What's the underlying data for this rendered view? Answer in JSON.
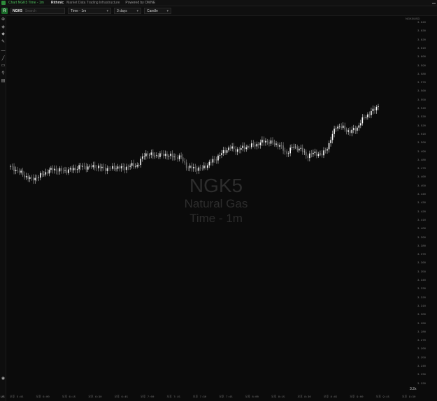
{
  "window": {
    "title": "Chart NGK5 Time - 1m",
    "brand": "Rithmic",
    "tagline": "Market Data Trading Infrastructure",
    "powered_by": "Powered by OMNE"
  },
  "toolbar": {
    "logo_glyph": "R",
    "symbol": "NGK5",
    "symbol_placeholder": "Search",
    "timeframe": "Time - 1m",
    "range": "3 days",
    "chart_type": "Candle"
  },
  "watermark": {
    "symbol": "NGK5",
    "name": "Natural Gas",
    "timeframe": "Time - 1m"
  },
  "left_tools": [
    {
      "icon": "zoom-icon",
      "glyph": "⊕"
    },
    {
      "icon": "layers-icon",
      "glyph": "◈"
    },
    {
      "icon": "drop-icon",
      "glyph": "◆"
    },
    {
      "icon": "pencil-icon",
      "glyph": "✎"
    },
    {
      "icon": "horizontal-line-icon",
      "glyph": "—"
    },
    {
      "icon": "trend-line-icon",
      "glyph": "╱"
    },
    {
      "icon": "rectangle-icon",
      "glyph": "▭"
    },
    {
      "icon": "fib-icon",
      "glyph": "⚲"
    },
    {
      "icon": "text-tool-icon",
      "glyph": "▤"
    }
  ],
  "bottom_tools": {
    "eye_glyph": "◉",
    "timezone": "US"
  },
  "axis_unit": "NGK5/USD",
  "zoom_label": "3.2x",
  "price_axis": [
    "3.640",
    "3.630",
    "3.620",
    "3.610",
    "3.600",
    "3.590",
    "3.580",
    "3.570",
    "3.560",
    "3.550",
    "3.540",
    "3.530",
    "3.520",
    "3.510",
    "3.500",
    "3.490",
    "3.480",
    "3.470",
    "3.460",
    "3.450",
    "3.440",
    "3.430",
    "3.420",
    "3.410",
    "3.400",
    "3.390",
    "3.380",
    "3.370",
    "3.360",
    "3.350",
    "3.340",
    "3.330",
    "3.320",
    "3.310",
    "3.300",
    "3.290",
    "3.280",
    "3.270",
    "3.260",
    "3.250",
    "3.240",
    "3.230",
    "3.220"
  ],
  "time_axis": [
    "오후 5:45",
    "오후 6:00",
    "오후 6:15",
    "오후 6:30",
    "오후 6:45",
    "오후 7:00",
    "오후 7:15",
    "오후 7:30",
    "오후 7:45",
    "오후 8:00",
    "오후 8:15",
    "오후 8:30",
    "오후 8:45",
    "오후 9:00",
    "오후 9:15",
    "오후 9:30"
  ],
  "chart_data": {
    "type": "candlestick",
    "ylim": [
      3.22,
      3.64
    ],
    "x": [
      "5:45",
      "5:49",
      "5:53",
      "5:57",
      "6:01",
      "6:05",
      "6:09",
      "6:13",
      "6:17",
      "6:21",
      "6:25",
      "6:29",
      "6:33",
      "6:37",
      "6:41",
      "6:45",
      "6:49",
      "6:53",
      "6:57",
      "7:01",
      "7:05",
      "7:09",
      "7:13",
      "7:17",
      "7:21",
      "7:25",
      "7:29",
      "7:33",
      "7:37",
      "7:41",
      "7:45",
      "7:49",
      "7:53",
      "7:57",
      "8:01",
      "8:05",
      "8:09",
      "8:13",
      "8:17",
      "8:21",
      "8:25",
      "8:29",
      "8:33",
      "8:37",
      "8:41",
      "8:45",
      "8:49",
      "8:53",
      "8:57",
      "9:01",
      "9:05",
      "9:09",
      "9:13"
    ],
    "close": [
      3.472,
      3.468,
      3.462,
      3.458,
      3.461,
      3.466,
      3.47,
      3.468,
      3.468,
      3.47,
      3.473,
      3.472,
      3.473,
      3.471,
      3.47,
      3.472,
      3.471,
      3.474,
      3.474,
      3.488,
      3.486,
      3.486,
      3.487,
      3.484,
      3.484,
      3.472,
      3.471,
      3.47,
      3.476,
      3.482,
      3.489,
      3.495,
      3.492,
      3.495,
      3.497,
      3.499,
      3.503,
      3.5,
      3.498,
      3.488,
      3.496,
      3.493,
      3.485,
      3.489,
      3.486,
      3.498,
      3.52,
      3.518,
      3.513,
      3.518,
      3.53,
      3.536,
      3.544
    ]
  }
}
